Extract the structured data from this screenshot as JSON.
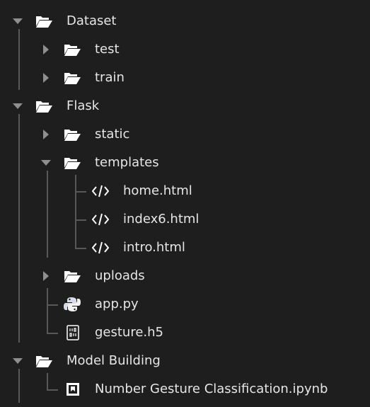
{
  "tree": {
    "items": [
      {
        "label": "Dataset",
        "kind": "folder",
        "expanded": true
      },
      {
        "label": "test",
        "kind": "folder",
        "expanded": false
      },
      {
        "label": "train",
        "kind": "folder",
        "expanded": false
      },
      {
        "label": "Flask",
        "kind": "folder",
        "expanded": true
      },
      {
        "label": "static",
        "kind": "folder",
        "expanded": false
      },
      {
        "label": "templates",
        "kind": "folder",
        "expanded": true
      },
      {
        "label": "home.html",
        "kind": "html-file",
        "icon": "code-icon"
      },
      {
        "label": "index6.html",
        "kind": "html-file",
        "icon": "code-icon"
      },
      {
        "label": "intro.html",
        "kind": "html-file",
        "icon": "code-icon"
      },
      {
        "label": "uploads",
        "kind": "folder",
        "expanded": false
      },
      {
        "label": "app.py",
        "kind": "python-file",
        "icon": "python-icon"
      },
      {
        "label": "gesture.h5",
        "kind": "binary-file",
        "icon": "binary-file-icon"
      },
      {
        "label": "Model Building",
        "kind": "folder",
        "expanded": true
      },
      {
        "label": "Number Gesture Classification.ipynb",
        "kind": "notebook-file",
        "icon": "notebook-icon"
      }
    ]
  },
  "colors": {
    "background": "#1e1e1e",
    "text": "#e6e6e6",
    "folder": "#ffffff",
    "guide": "#585858",
    "chevron": "#8f8f8f",
    "python_blue": "#d8dce6",
    "python_yellow": "#f2f2f2"
  }
}
